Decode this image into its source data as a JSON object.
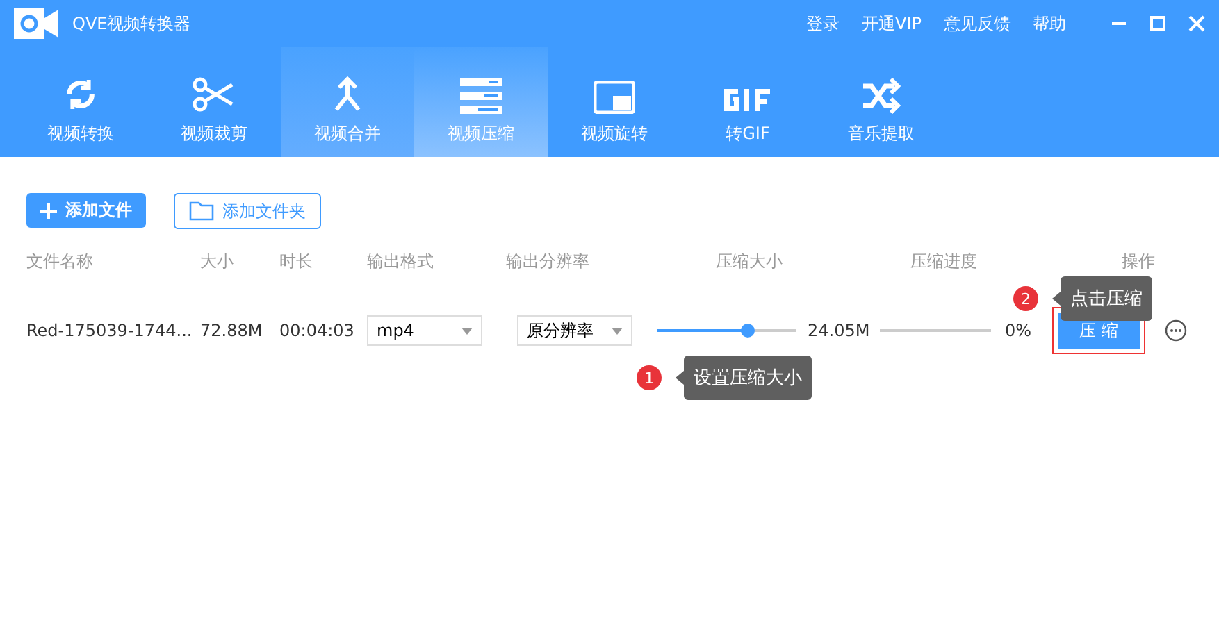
{
  "window": {
    "title": "QVE视频转换器",
    "links": [
      "登录",
      "开通VIP",
      "意见反馈",
      "帮助"
    ]
  },
  "tabs": [
    {
      "label": "视频转换",
      "kind": "convert",
      "selected": false,
      "hovered": false
    },
    {
      "label": "视频裁剪",
      "kind": "scissors",
      "selected": false,
      "hovered": false
    },
    {
      "label": "视频合并",
      "kind": "merge",
      "selected": false,
      "hovered": true
    },
    {
      "label": "视频压缩",
      "kind": "compress",
      "selected": true,
      "hovered": false
    },
    {
      "label": "视频旋转",
      "kind": "rotate",
      "selected": false,
      "hovered": false
    },
    {
      "label": "转GIF",
      "kind": "gif",
      "selected": false,
      "hovered": false
    },
    {
      "label": "音乐提取",
      "kind": "shuffle",
      "selected": false,
      "hovered": false
    }
  ],
  "actions": {
    "add_file": "添加文件",
    "add_folder": "添加文件夹"
  },
  "table": {
    "columns": [
      "文件名称",
      "大小",
      "时长",
      "输出格式",
      "输出分辨率",
      "压缩大小",
      "压缩进度",
      "操作"
    ],
    "rows": [
      {
        "name": "Red-175039-1744...",
        "size": "72.88M",
        "duration": "00:04:03",
        "format": "mp4",
        "resolution": "原分辨率",
        "level": 0.65,
        "compressed_size": "24.05M",
        "progress": {
          "level": 0,
          "reading": "0%"
        },
        "button": "压 缩"
      }
    ]
  },
  "tips": [
    {
      "number": "1",
      "text": "设置压缩大小"
    },
    {
      "number": "2",
      "text": "点击压缩"
    }
  ]
}
